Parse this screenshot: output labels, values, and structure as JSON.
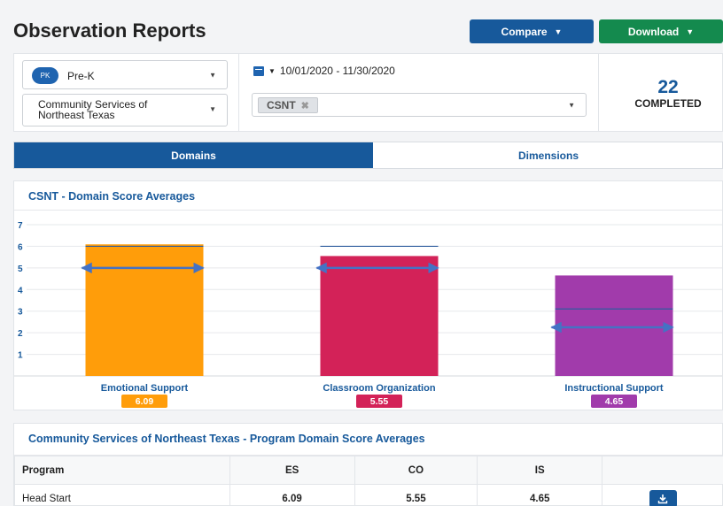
{
  "page": {
    "title": "Observation Reports"
  },
  "header": {
    "compare_label": "Compare",
    "download_label": "Download"
  },
  "filters": {
    "grade_badge": "PK",
    "grade_value": "Pre-K",
    "organization_value": "Community Services of Northeast Texas",
    "date_range": "10/01/2020  -  11/30/2020",
    "tag_value": "CSNT"
  },
  "summary": {
    "count": "22",
    "label": "COMPLETED"
  },
  "tabs": [
    {
      "label": "Domains",
      "active": true
    },
    {
      "label": "Dimensions",
      "active": false
    }
  ],
  "chart_data": {
    "type": "bar",
    "title": "CSNT - Domain Score Averages",
    "categories": [
      "Emotional Support",
      "Classroom Organization",
      "Instructional Support"
    ],
    "values": [
      6.09,
      5.55,
      4.65
    ],
    "value_labels": [
      "6.09",
      "5.55",
      "4.65"
    ],
    "colors": [
      "#ff9d0a",
      "#d32258",
      "#a13bab"
    ],
    "ylim": [
      0,
      7
    ],
    "yticks": [
      "1",
      "2",
      "3",
      "4",
      "5",
      "6",
      "7"
    ],
    "grid": true,
    "reference_lines": [
      6.0,
      6.0,
      3.1
    ],
    "range_arrows": [
      5.0,
      5.0,
      2.25
    ]
  },
  "program_table": {
    "title": "Community Services of Northeast Texas - Program Domain Score Averages",
    "columns": [
      "Program",
      "ES",
      "CO",
      "IS",
      ""
    ],
    "rows": [
      {
        "program": "Head Start",
        "es": "6.09",
        "co": "5.55",
        "is": "4.65"
      }
    ]
  },
  "icons": {
    "calendar": "calendar-icon",
    "download_row": "download-icon"
  }
}
